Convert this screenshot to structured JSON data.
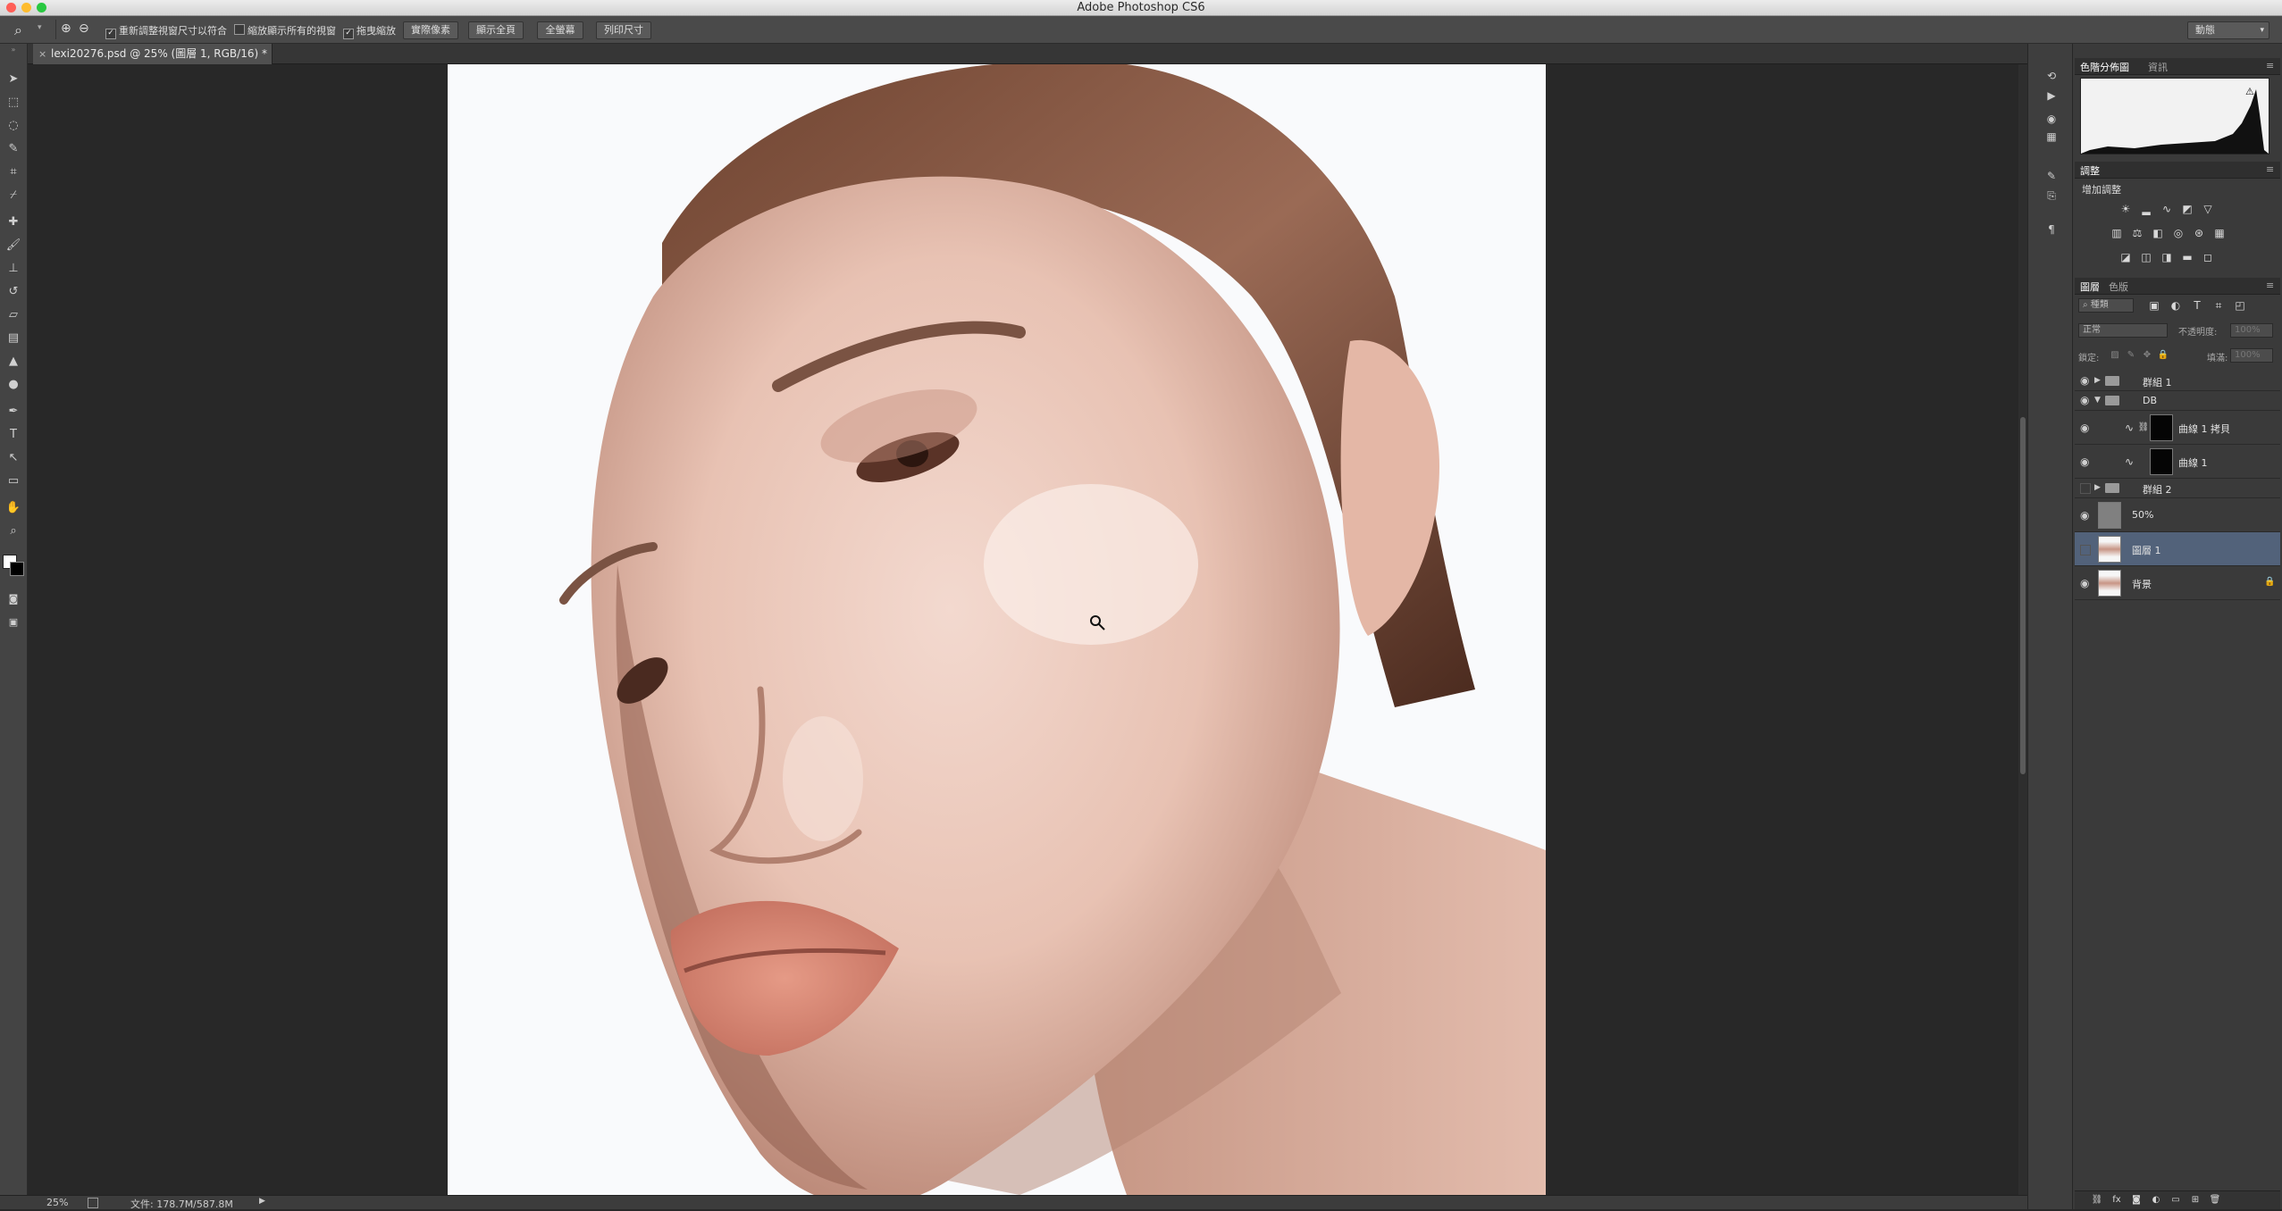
{
  "window": {
    "title": "Adobe Photoshop CS6",
    "traffic_lights": {
      "close": "#ff5f57",
      "minimize": "#febc2e",
      "zoom": "#28c840"
    }
  },
  "options_bar": {
    "tool_icon": "zoom-icon",
    "zoom_in_icon": "zoom-in-icon",
    "zoom_out_icon": "zoom-out-icon",
    "resize_windows_label": "重新調整視窗尺寸以符合",
    "zoom_all_windows_label": "縮放顯示所有的視窗",
    "scrubby_zoom_label": "拖曳縮放",
    "actual_pixels_label": "實際像素",
    "fit_screen_label": "顯示全頁",
    "fill_screen_label": "全螢幕",
    "print_size_label": "列印尺寸",
    "workspace_label": "動態"
  },
  "document": {
    "tab_title": "lexi20276.psd @ 25% (圖層 1, RGB/16) *",
    "close_glyph": "×"
  },
  "status_bar": {
    "zoom": "25%",
    "doc_size": "文件: 178.7M/587.8M"
  },
  "panels": {
    "histogram_tab": "色階分佈圖",
    "info_tab": "資訊",
    "adjustments_tab": "調整",
    "adjustments_subtitle": "增加調整",
    "layers_tab": "圖層",
    "channels_tab": "色版",
    "filter_kind": "種類",
    "blend_mode": "正常",
    "opacity_label": "不透明度:",
    "opacity_value": "100%",
    "lock_label": "鎖定:",
    "fill_label": "填滿:",
    "fill_value": "100%"
  },
  "layers": [
    {
      "name": "群組 1",
      "type": "group",
      "expanded": false,
      "visible": true
    },
    {
      "name": "DB",
      "type": "group",
      "expanded": true,
      "visible": true
    },
    {
      "name": "曲線 1 拷貝",
      "type": "adjustment",
      "visible": true
    },
    {
      "name": "曲線 1",
      "type": "adjustment",
      "visible": true
    },
    {
      "name": "群組 2",
      "type": "group",
      "expanded": false,
      "visible": false
    },
    {
      "name": "50%",
      "type": "pixel",
      "visible": true
    },
    {
      "name": "圖層 1",
      "type": "pixel",
      "visible": false,
      "selected": true
    },
    {
      "name": "背景",
      "type": "pixel",
      "visible": true,
      "locked": true
    }
  ],
  "colors": {
    "accent_selected_layer": "#52627a",
    "panel_bg": "#3a3a3a",
    "canvas_bg": "#282828"
  }
}
